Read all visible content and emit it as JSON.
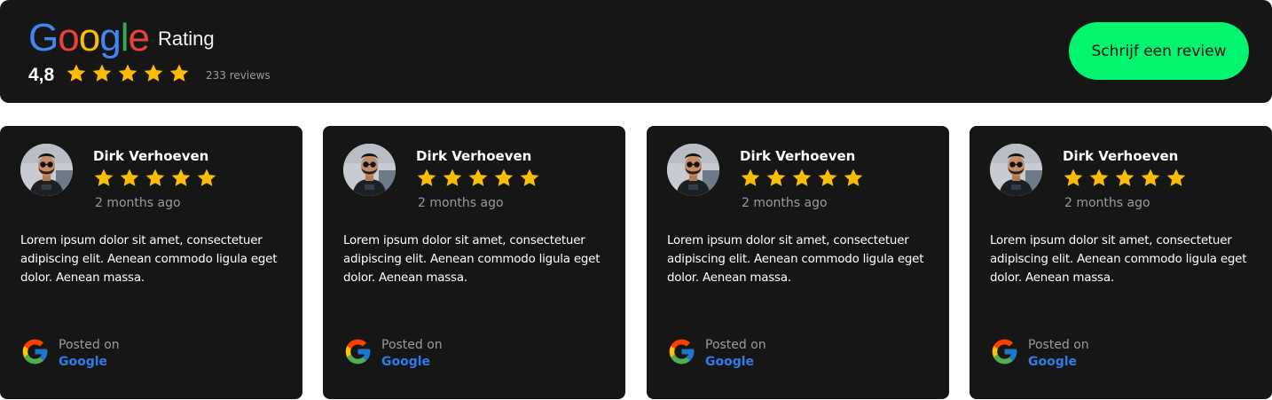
{
  "header": {
    "logo_letters": [
      {
        "char": "G",
        "color": "#4285F4"
      },
      {
        "char": "o",
        "color": "#EA4335"
      },
      {
        "char": "o",
        "color": "#FBBC05"
      },
      {
        "char": "g",
        "color": "#4285F4"
      },
      {
        "char": "l",
        "color": "#34A853"
      },
      {
        "char": "e",
        "color": "#EA4335"
      }
    ],
    "rating_label": "Rating",
    "score": "4,8",
    "stars": 5,
    "reviews_count": "233 reviews",
    "cta_label": "Schrijf een review"
  },
  "colors": {
    "star": "#FBBC05",
    "cta": "#03F56F",
    "card_bg": "#161616",
    "link": "#2F7BE8"
  },
  "reviews": [
    {
      "name": "Dirk Verhoeven",
      "stars": 5,
      "time": "2 months ago",
      "text": "Lorem ipsum dolor sit amet, consectetuer adipiscing elit. Aenean commodo ligula eget dolor. Aenean massa.",
      "posted_on": "Posted on",
      "platform": "Google"
    },
    {
      "name": "Dirk Verhoeven",
      "stars": 5,
      "time": "2 months ago",
      "text": "Lorem ipsum dolor sit amet, consectetuer adipiscing elit. Aenean commodo ligula eget dolor. Aenean massa.",
      "posted_on": "Posted on",
      "platform": "Google"
    },
    {
      "name": "Dirk Verhoeven",
      "stars": 5,
      "time": "2 months ago",
      "text": "Lorem ipsum dolor sit amet, consectetuer adipiscing elit. Aenean commodo ligula eget dolor. Aenean massa.",
      "posted_on": "Posted on",
      "platform": "Google"
    },
    {
      "name": "Dirk Verhoeven",
      "stars": 5,
      "time": "2 months ago",
      "text": "Lorem ipsum dolor sit amet, consectetuer adipiscing elit. Aenean commodo ligula eget dolor. Aenean massa.",
      "posted_on": "Posted on",
      "platform": "Google"
    }
  ]
}
